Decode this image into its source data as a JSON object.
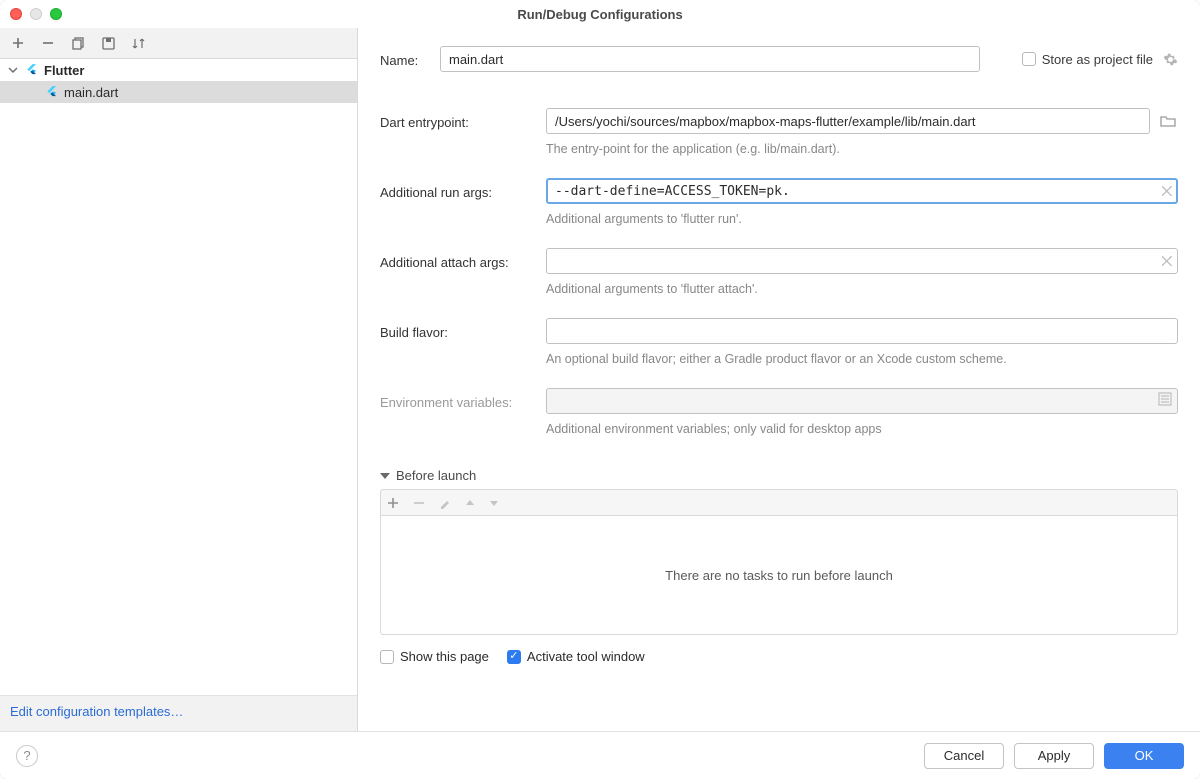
{
  "window": {
    "title": "Run/Debug Configurations"
  },
  "sidebar": {
    "group": "Flutter",
    "item": "main.dart",
    "edit_templates": "Edit configuration templates…"
  },
  "form": {
    "name_label": "Name:",
    "name_value": "main.dart",
    "store_label": "Store as project file",
    "entry_label": "Dart entrypoint:",
    "entry_value": "/Users/yochi/sources/mapbox/mapbox-maps-flutter/example/lib/main.dart",
    "entry_hint": "The entry-point for the application (e.g. lib/main.dart).",
    "run_args_label": "Additional run args:",
    "run_args_value": "--dart-define=ACCESS_TOKEN=pk.",
    "run_args_hint": "Additional arguments to 'flutter run'.",
    "attach_args_label": "Additional attach args:",
    "attach_args_value": "",
    "attach_args_hint": "Additional arguments to 'flutter attach'.",
    "flavor_label": "Build flavor:",
    "flavor_value": "",
    "flavor_hint": "An optional build flavor; either a Gradle product flavor or an Xcode custom scheme.",
    "env_label": "Environment variables:",
    "env_value": "",
    "env_hint": "Additional environment variables; only valid for desktop apps"
  },
  "before_launch": {
    "header": "Before launch",
    "empty": "There are no tasks to run before launch",
    "show_page": "Show this page",
    "activate_window": "Activate tool window"
  },
  "buttons": {
    "cancel": "Cancel",
    "apply": "Apply",
    "ok": "OK"
  }
}
